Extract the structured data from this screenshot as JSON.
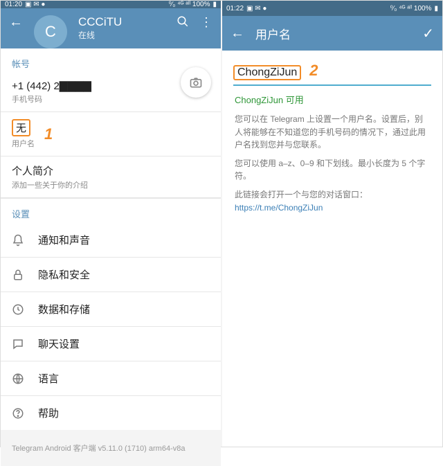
{
  "left": {
    "status": {
      "time": "01:20",
      "right": "⁰⁄₀   ⁴ᴳ ᵃˡˡ 100%"
    },
    "profile": {
      "avatar_letter": "C",
      "name": "CCCiTU",
      "status": "在线"
    },
    "section_account": "帐号",
    "phone": {
      "value": "+1 (442) 2▇▇▇▇",
      "label": "手机号码"
    },
    "username": {
      "value": "无",
      "label": "用户名"
    },
    "bio": {
      "value": "个人简介",
      "label": "添加一些关于你的介绍"
    },
    "section_settings": "设置",
    "items": [
      {
        "icon": "bell",
        "label": "通知和声音"
      },
      {
        "icon": "lock",
        "label": "隐私和安全"
      },
      {
        "icon": "clock",
        "label": "数据和存储"
      },
      {
        "icon": "chat",
        "label": "聊天设置"
      },
      {
        "icon": "globe",
        "label": "语言"
      },
      {
        "icon": "help",
        "label": "帮助"
      }
    ],
    "footer": "Telegram Android 客户端 v5.11.0 (1710) arm64-v8a",
    "anno1": "1"
  },
  "right": {
    "status": {
      "time": "01:22",
      "right": "⁰⁄₀   ⁴ᴳ ᵃˡˡ 100%"
    },
    "title": "用户名",
    "input": "ChongZiJun",
    "ok": "ChongZiJun 可用",
    "p1": "您可以在 Telegram 上设置一个用户名。设置后，别人将能够在不知道您的手机号码的情况下，通过此用户名找到您并与您联系。",
    "p2": "您可以使用 a–z、0–9 和下划线。最小长度为 5 个字符。",
    "p3_pre": "此链接会打开一个与您的对话窗口：",
    "p3_link": "https://t.me/ChongZiJun",
    "anno2": "2"
  }
}
